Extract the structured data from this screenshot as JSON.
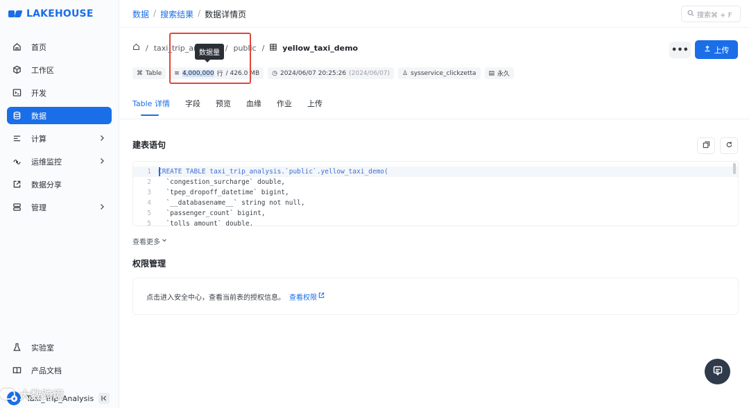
{
  "app": {
    "logo_text": "LAKEHOUSE",
    "brand_color": "#1a6ee8",
    "alert_color": "#e0453a"
  },
  "sidebar": {
    "items": [
      {
        "label": "首页",
        "icon": "home-icon"
      },
      {
        "label": "工作区",
        "icon": "cube-icon"
      },
      {
        "label": "开发",
        "icon": "terminal-icon"
      },
      {
        "label": "数据",
        "icon": "database-icon",
        "active": true
      },
      {
        "label": "计算",
        "icon": "compute-icon",
        "expandable": true
      },
      {
        "label": "运维监控",
        "icon": "monitor-icon",
        "expandable": true
      },
      {
        "label": "数据分享",
        "icon": "share-icon"
      },
      {
        "label": "管理",
        "icon": "server-icon",
        "expandable": true
      }
    ],
    "bottom_items": [
      {
        "label": "实验室",
        "icon": "flask-icon"
      },
      {
        "label": "产品文档",
        "icon": "book-icon"
      }
    ],
    "user_name": "Taxi_Trip_Analysis"
  },
  "header": {
    "breadcrumb": [
      "数据",
      "搜索结果",
      "数据详情页"
    ],
    "search_placeholder": "搜索⌘ + F"
  },
  "table": {
    "path_schema": "taxi_trip_analysis",
    "path_sub": "public",
    "name": "yellow_taxi_demo",
    "type": "Table",
    "rows": "4,000,000",
    "rows_unit": "行",
    "size": "/ 426.0 MB",
    "created": "2024/06/07 20:25:26",
    "created_paren": "(2024/06/07)",
    "owner": "sysservice_clickzetta",
    "lifecycle": "永久",
    "tooltip": "数据量",
    "more_label": "•••",
    "upload_label": "上传"
  },
  "tabs": [
    "Table 详情",
    "字段",
    "预览",
    "血缘",
    "作业",
    "上传"
  ],
  "create_stmt": {
    "title": "建表语句",
    "lines": [
      {
        "n": "1",
        "text": "CREATE TABLE taxi_trip_analysis.`public`.yellow_taxi_demo("
      },
      {
        "n": "2",
        "text": "  `congestion_surcharge` double,"
      },
      {
        "n": "3",
        "text": "  `tpep_dropoff_datetime` bigint,"
      },
      {
        "n": "4",
        "text": "  `__databasename__` string not null,"
      },
      {
        "n": "5",
        "text": "  `passenger_count` bigint,"
      },
      {
        "n": "5",
        "text": "  `tolls_amount` double,"
      }
    ],
    "see_more": "查看更多"
  },
  "permissions": {
    "title": "权限管理",
    "text": "点击进入安全中心，查看当前表的授权信息。",
    "link": "查看权限"
  },
  "watermark": "大数跨境"
}
